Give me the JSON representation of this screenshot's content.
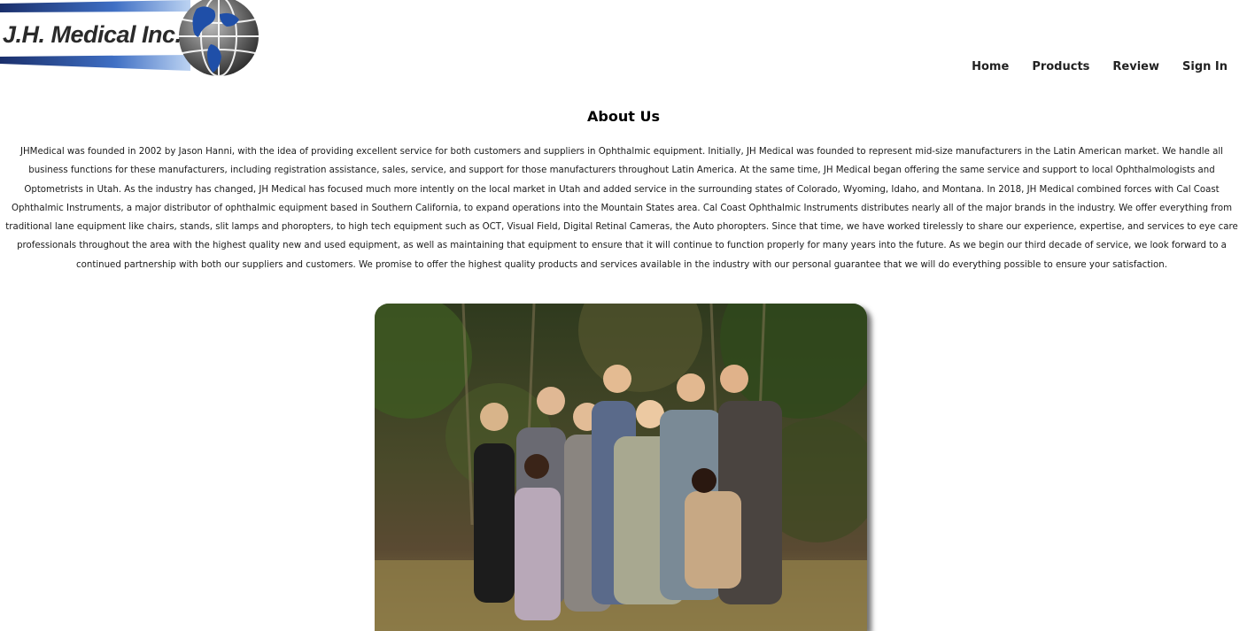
{
  "header": {
    "logo_text": "J.H. Medical Inc.",
    "nav": [
      {
        "label": "Home"
      },
      {
        "label": "Products"
      },
      {
        "label": "Review"
      },
      {
        "label": "Sign In"
      }
    ]
  },
  "main": {
    "title": "About Us",
    "body": "JHMedical was founded in 2002 by Jason Hanni, with the idea of providing excellent service for both customers and suppliers in Ophthalmic equipment. Initially, JH Medical was founded to represent mid-size manufacturers in the Latin American market. We handle all business functions for these manufacturers, including registration assistance, sales, service, and support for those manufacturers throughout Latin America. At the same time, JH Medical began offering the same service and support to local Ophthalmologists and Optometrists in Utah. As the industry has changed, JH Medical has focused much more intently on the local market in Utah and added service in the surrounding states of Colorado, Wyoming, Idaho, and Montana. In 2018, JH Medical combined forces with Cal Coast Ophthalmic Instruments, a major distributor of ophthalmic equipment based in Southern California, to expand operations into the Mountain States area. Cal Coast Ophthalmic Instruments distributes nearly all of the major brands in the industry. We offer everything from traditional lane equipment like chairs, stands, slit lamps and phoropters, to high tech equipment such as OCT, Visual Field, Digital Retinal Cameras, the Auto phoropters. Since that time, we have worked tirelessly to share our experience, expertise, and services to eye care professionals throughout the area with the highest quality new and used equipment, as well as maintaining that equipment to ensure that it will continue to function properly for many years into the future. As we begin our third decade of service, we look forward to a continued partnership with both our suppliers and customers. We promise to offer the highest quality products and services available in the industry with our personal guarantee that we will do everything possible to ensure your satisfaction."
  },
  "colors": {
    "logo_blue": "#1f4fa8",
    "globe_gray": "#555555",
    "text": "#1a1a1a"
  }
}
